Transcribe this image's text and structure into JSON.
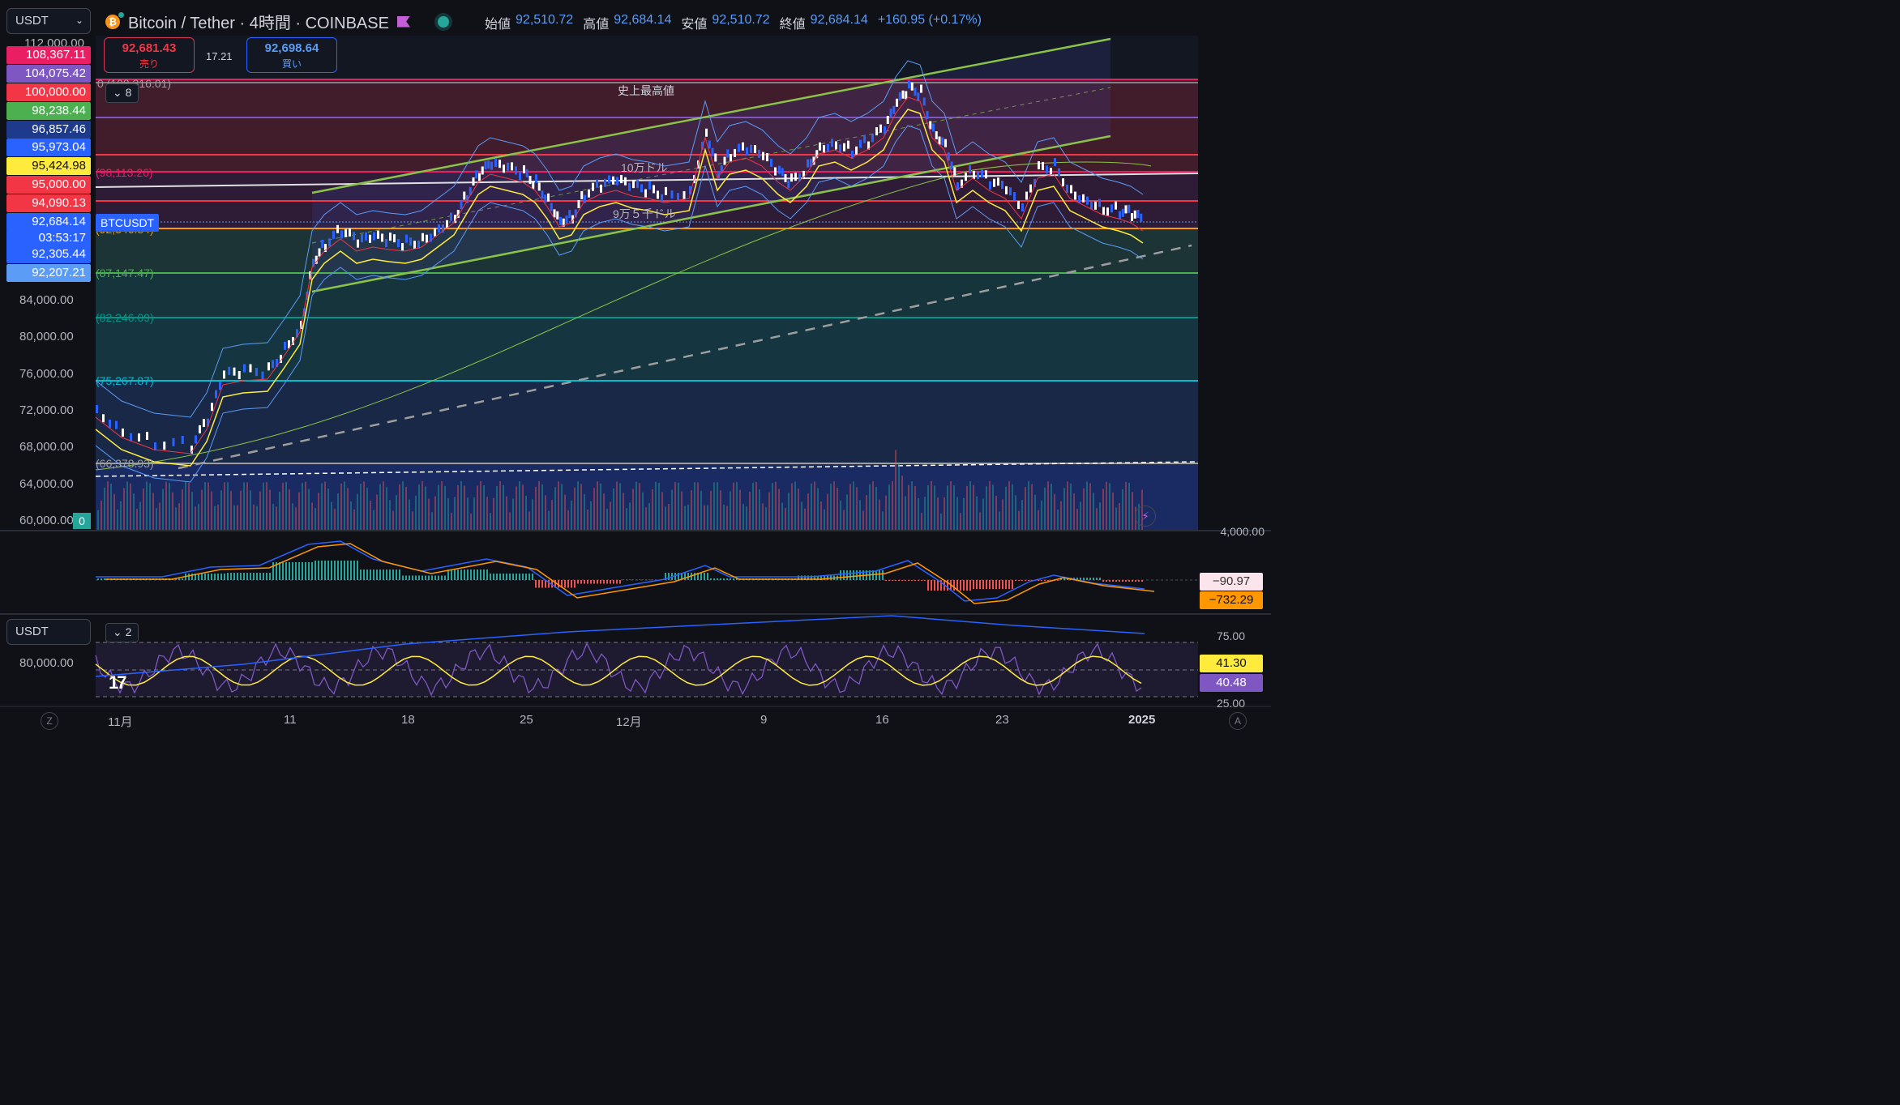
{
  "header": {
    "currency_select": "USDT",
    "title": "Bitcoin / Tether · 4時間 · COINBASE",
    "ohlc": [
      {
        "key": "始値",
        "value": "92,510.72"
      },
      {
        "key": "高値",
        "value": "92,684.14"
      },
      {
        "key": "安値",
        "value": "92,510.72"
      },
      {
        "key": "終値",
        "value": "92,684.14"
      }
    ],
    "change": "+160.95 (+0.17%)"
  },
  "trade": {
    "sell_price": "92,681.43",
    "sell_label": "売り",
    "spread": "17.21",
    "buy_price": "92,698.64",
    "buy_label": "買い"
  },
  "left_axis": {
    "top_label": "112,000.00",
    "tags": [
      {
        "value": "108,367.11",
        "color": "#e91e63"
      },
      {
        "value": "104,075.42",
        "color": "#7e57c2"
      },
      {
        "value": "100,000.00",
        "color": "#f23645"
      },
      {
        "value": "98,238.44",
        "color": "#4caf50"
      },
      {
        "value": "96,857.46",
        "color": "#1e3a8a"
      },
      {
        "value": "95,973.04",
        "color": "#2962ff"
      },
      {
        "value": "95,424.98",
        "color": "#ffeb3b"
      },
      {
        "value": "95,000.00",
        "color": "#f23645"
      },
      {
        "value": "94,090.13",
        "color": "#f23645"
      },
      {
        "value": "92,684.14",
        "color": "#2962ff"
      },
      {
        "value": "03:53:17",
        "color": "#2962ff"
      },
      {
        "value": "92,305.44",
        "color": "#2962ff"
      },
      {
        "value": "92,207.21",
        "color": "#5b9cf6"
      }
    ],
    "ticks": [
      "84,000.00",
      "80,000.00",
      "76,000.00",
      "72,000.00",
      "68,000.00",
      "64,000.00",
      "60,000.00"
    ],
    "volume_tag": "0"
  },
  "fib_labels": [
    {
      "text": "0 (108,316.01)"
    },
    {
      "text": "(98,113.26)"
    },
    {
      "text": "(92,346.84)"
    },
    {
      "text": "(87,147.47)"
    },
    {
      "text": "(82,246.09)"
    },
    {
      "text": "(75,267.87)"
    },
    {
      "text": "(66,378.93)"
    }
  ],
  "annotations": {
    "ath": "史上最高値",
    "ten_man": "10万ドル",
    "nine_five": "9万５千ドル",
    "symbol_tag": "BTCUSDT",
    "collapse_main": "8",
    "collapse_rsi": "2"
  },
  "macd": {
    "axis_top": "4,000.00",
    "tag1": "−90.97",
    "tag2": "−732.29"
  },
  "rsi": {
    "currency_select": "USDT",
    "left_tick": "80,000.00",
    "axis": [
      "75.00",
      "25.00"
    ],
    "tag1": "41.30",
    "tag2": "40.48"
  },
  "x_axis": [
    "11月",
    "11",
    "18",
    "25",
    "12月",
    "9",
    "16",
    "23",
    "2025"
  ],
  "corner": {
    "left": "Z",
    "right": "A"
  },
  "colors": {
    "up": "#ffffff",
    "down": "#2962ff",
    "accent": "#2962ff"
  }
}
